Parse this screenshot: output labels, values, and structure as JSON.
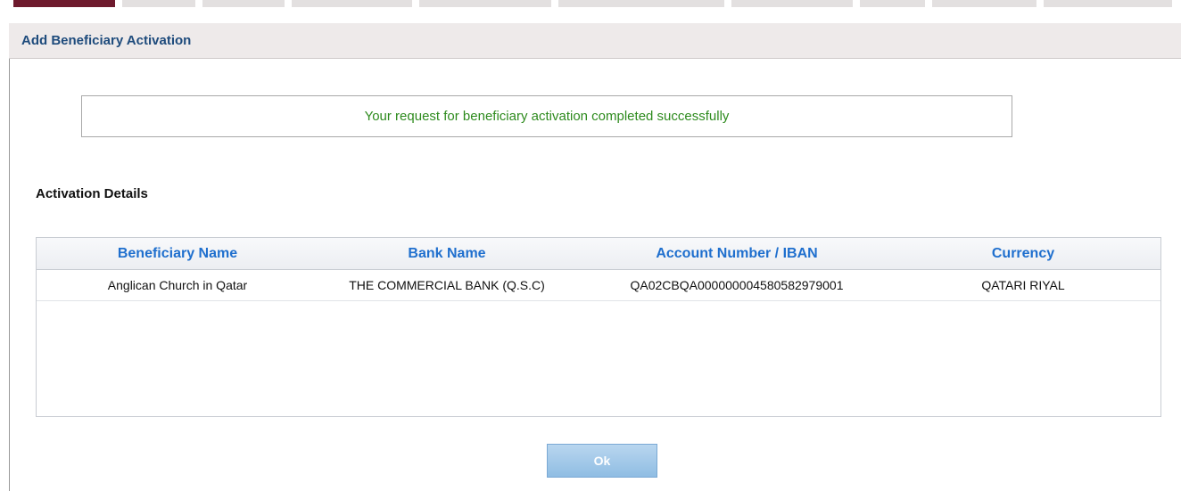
{
  "dialog": {
    "title": "Add Beneficiary Activation"
  },
  "message": {
    "success_text": "Your request for beneficiary activation completed successfully"
  },
  "details": {
    "section_title": "Activation Details",
    "columns": [
      "Beneficiary Name",
      "Bank Name",
      "Account Number / IBAN",
      "Currency"
    ],
    "rows": [
      [
        "Anglican Church in Qatar",
        "THE COMMERCIAL BANK (Q.S.C)",
        "QA02CBQA000000004580582979001",
        "QATARI RIYAL"
      ]
    ]
  },
  "actions": {
    "ok_label": "Ok"
  },
  "colors": {
    "title": "#1e4b7c",
    "success": "#2e8b1e",
    "header_text": "#1f6fce",
    "active_tab": "#6e1a2d"
  }
}
